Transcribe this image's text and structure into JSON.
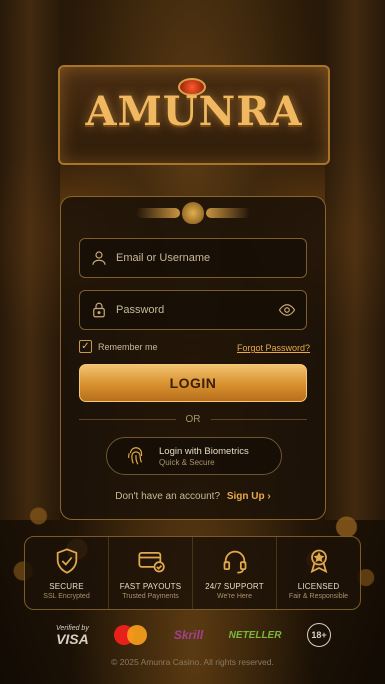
{
  "brand": {
    "logo_text": "AMUNRA"
  },
  "login_form": {
    "email_placeholder": "Email or Username",
    "password_placeholder": "Password",
    "remember_label": "Remember me",
    "remember_checked": true,
    "forgot_link": "Forgot Password?",
    "login_button": "LOGIN",
    "divider": "OR",
    "biometrics_title": "Login with Biometrics",
    "biometrics_subtitle": "Quick & Secure",
    "signup_prompt": "Don't have an account?",
    "signup_link": "Sign Up"
  },
  "features": [
    {
      "icon": "shield-check-icon",
      "title": "SECURE",
      "subtitle": "SSL Encrypted"
    },
    {
      "icon": "card-icon",
      "title": "FAST PAYOUTS",
      "subtitle": "Trusted Payments"
    },
    {
      "icon": "headset-icon",
      "title": "24/7 SUPPORT",
      "subtitle": "We're Here"
    },
    {
      "icon": "medal-icon",
      "title": "LICENSED",
      "subtitle": "Fair & Responsible"
    }
  ],
  "payments": {
    "visa_top": "Verified by",
    "visa_main": "VISA",
    "skrill": "Skrill",
    "neteller": "NETELLER",
    "age": "18+"
  },
  "footer": {
    "copyright": "© 2025 Amunra Casino. All rights reserved."
  },
  "colors": {
    "accent": "#e8a94a",
    "button": "#d7902e",
    "card_bg": "#1c1208"
  }
}
